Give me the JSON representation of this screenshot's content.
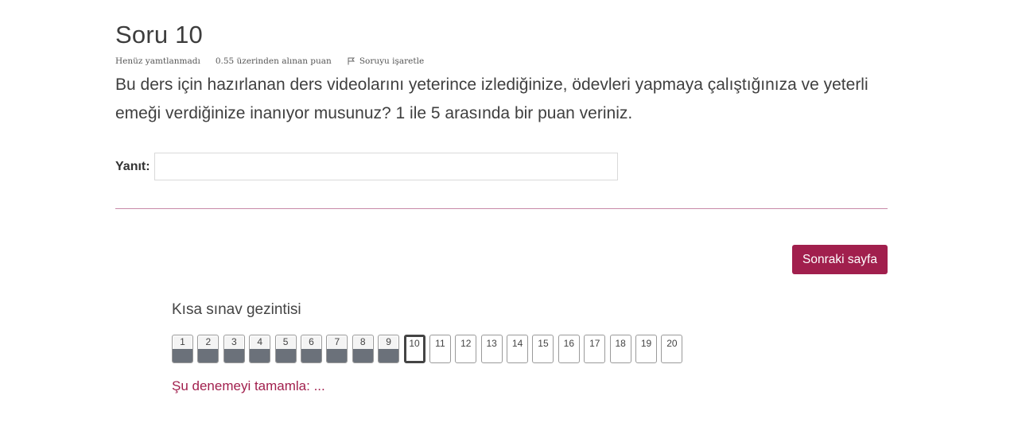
{
  "question": {
    "title": "Soru 10",
    "status": "Henüz yamtlanmadı",
    "points": "0.55 üzerinden alınan puan",
    "flag_label": "Soruyu işaretle",
    "text": "Bu ders için hazırlanan ders videolarını yeterince izlediğinize, ödevleri yapmaya çalıştığınıza ve yeterli emeği verdiğinize inanıyor musunuz? 1 ile 5 arasında bir puan veriniz."
  },
  "answer": {
    "label": "Yanıt:",
    "value": ""
  },
  "next_button": "Sonraki sayfa",
  "navigation": {
    "title": "Kısa sınav gezintisi",
    "current": 10,
    "questions": [
      {
        "num": "1",
        "answered": true
      },
      {
        "num": "2",
        "answered": true
      },
      {
        "num": "3",
        "answered": true
      },
      {
        "num": "4",
        "answered": true
      },
      {
        "num": "5",
        "answered": true
      },
      {
        "num": "6",
        "answered": true
      },
      {
        "num": "7",
        "answered": true
      },
      {
        "num": "8",
        "answered": true
      },
      {
        "num": "9",
        "answered": true
      },
      {
        "num": "10",
        "answered": false
      },
      {
        "num": "11",
        "answered": false
      },
      {
        "num": "12",
        "answered": false
      },
      {
        "num": "13",
        "answered": false
      },
      {
        "num": "14",
        "answered": false
      },
      {
        "num": "15",
        "answered": false
      },
      {
        "num": "16",
        "answered": false
      },
      {
        "num": "17",
        "answered": false
      },
      {
        "num": "18",
        "answered": false
      },
      {
        "num": "19",
        "answered": false
      },
      {
        "num": "20",
        "answered": false
      }
    ]
  },
  "finish_link": "Şu denemeyi tamamla: ...",
  "colors": {
    "accent": "#a11f4d",
    "answered_fill": "#6b717a",
    "divider": "#c88aa8"
  }
}
